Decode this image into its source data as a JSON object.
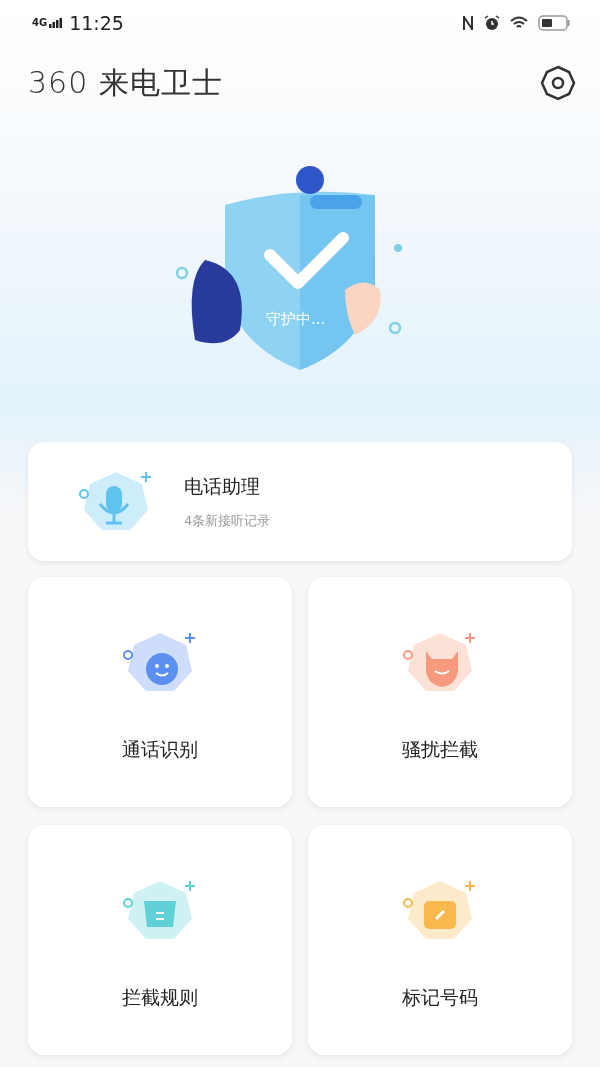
{
  "status_bar": {
    "network": "4G",
    "time": "11:25"
  },
  "header": {
    "title": "360 来电卫士"
  },
  "hero": {
    "status": "守护中..."
  },
  "assistant": {
    "title": "电话助理",
    "subtitle": "4条新接听记录",
    "color": "#5ec3ef"
  },
  "features": [
    {
      "kind": "identify",
      "label": "通话识别",
      "color": "#5b8ff0"
    },
    {
      "kind": "block",
      "label": "骚扰拦截",
      "color": "#f59a7c"
    },
    {
      "kind": "rules",
      "label": "拦截规则",
      "color": "#5fd0d6"
    },
    {
      "kind": "mark",
      "label": "标记号码",
      "color": "#f8b84e"
    }
  ]
}
